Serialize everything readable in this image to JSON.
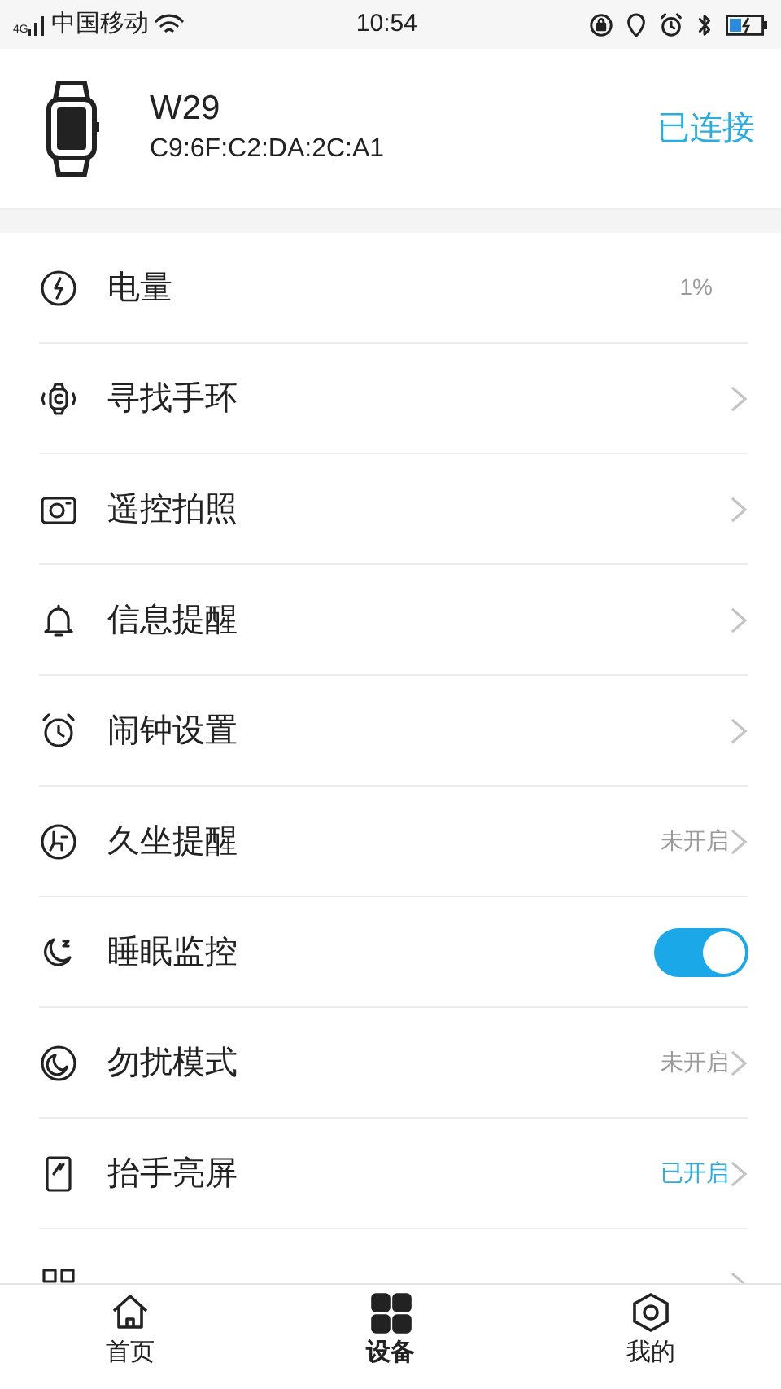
{
  "status_bar": {
    "network": "4G",
    "carrier": "中国移动",
    "time": "10:54"
  },
  "device": {
    "name": "W29",
    "mac": "C9:6F:C2:DA:2C:A1",
    "connection": "已连接"
  },
  "settings": [
    {
      "kind": "value",
      "label": "电量",
      "value": "1%"
    },
    {
      "kind": "link",
      "label": "寻找手环"
    },
    {
      "kind": "link",
      "label": "遥控拍照"
    },
    {
      "kind": "link",
      "label": "信息提醒"
    },
    {
      "kind": "link",
      "label": "闹钟设置"
    },
    {
      "kind": "status",
      "label": "久坐提醒",
      "value": "未开启",
      "on": false
    },
    {
      "kind": "toggle",
      "label": "睡眠监控",
      "on": true
    },
    {
      "kind": "status",
      "label": "勿扰模式",
      "value": "未开启",
      "on": false
    },
    {
      "kind": "status",
      "label": "抬手亮屏",
      "value": "已开启",
      "on": true
    },
    {
      "kind": "link"
    }
  ],
  "tab_bar": [
    {
      "label": "首页",
      "selected": false
    },
    {
      "label": "设备",
      "selected": true
    },
    {
      "label": "我的",
      "selected": false
    }
  ]
}
